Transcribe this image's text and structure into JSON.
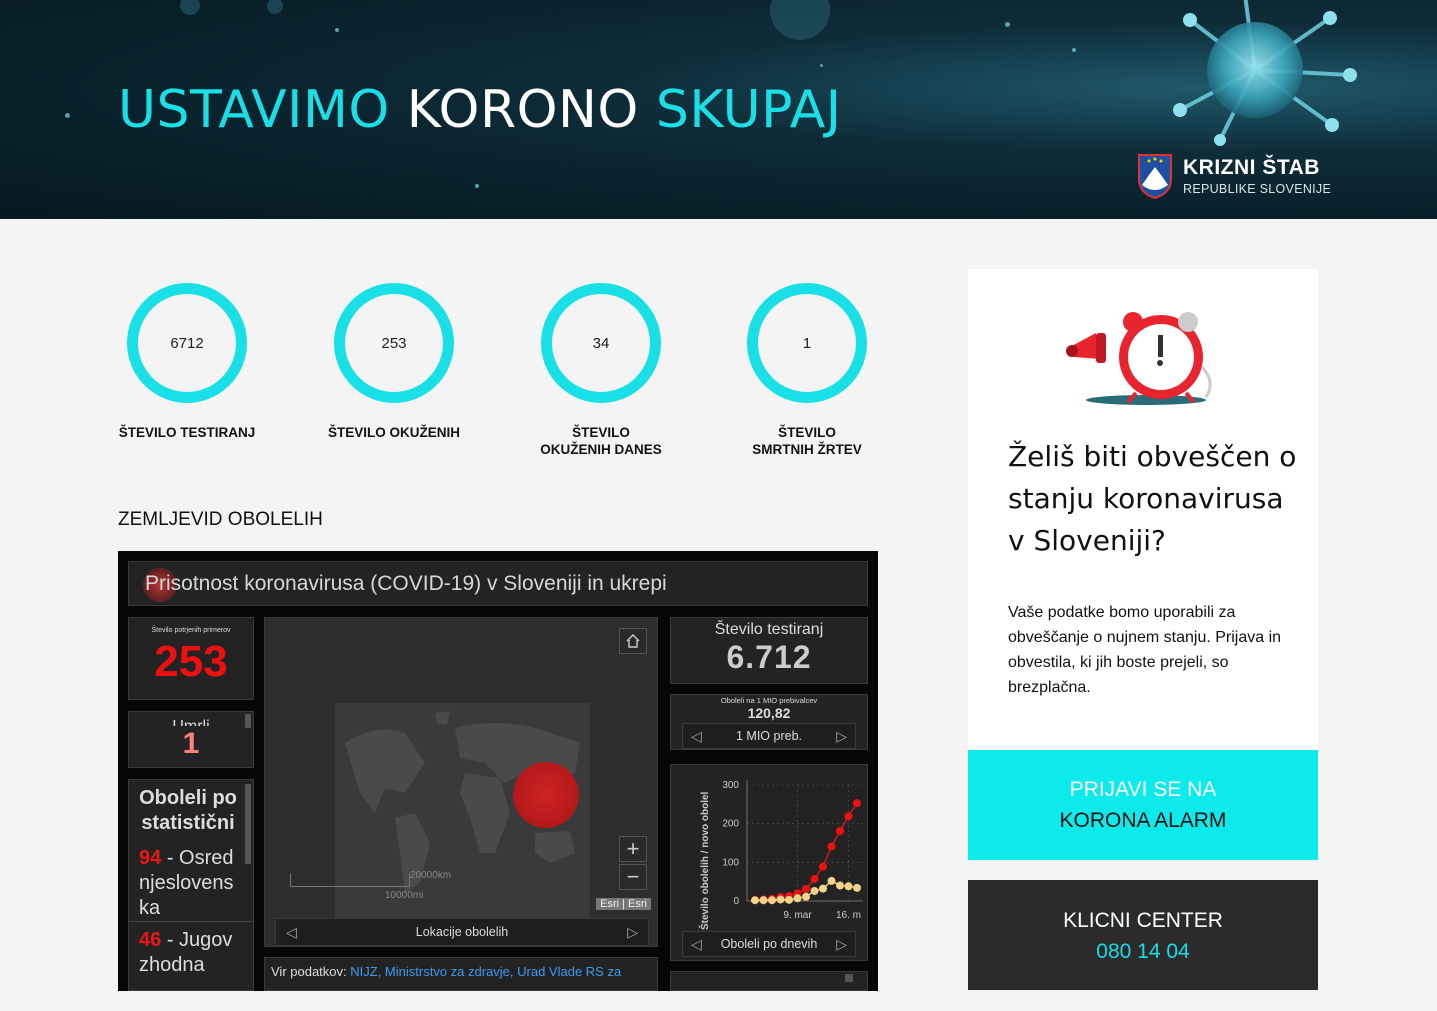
{
  "hero": {
    "title_part1": "USTAVIMO",
    "title_part2": "KORONO",
    "title_part3": "SKUPAJ",
    "logo_title": "KRIZNI ŠTAB",
    "logo_subtitle": "REPUBLIKE SLOVENIJE"
  },
  "stats": [
    {
      "value": "6712",
      "label": "ŠTEVILO TESTIRANJ"
    },
    {
      "value": "253",
      "label": "ŠTEVILO OKUŽENIH"
    },
    {
      "value": "34",
      "label": "ŠTEVILO OKUŽENIH DANES"
    },
    {
      "value": "1",
      "label": "ŠTEVILO SMRTNIH ŽRTEV"
    }
  ],
  "map_section_title": "ZEMLJEVID OBOLELIH",
  "dashboard": {
    "header": "Prisotnost koronavirusa (COVID-19) v Sloveniji in ukrepi",
    "confirmed_label": "Število potrjenih primerov",
    "confirmed_value": "253",
    "deaths_label": "Umrli",
    "deaths_value": "1",
    "regions_title": "Oboleli po statistični",
    "regions": [
      {
        "count": "94",
        "name": "Osrednjeslovenska"
      },
      {
        "count": "46",
        "name": "Jugovzhodna"
      }
    ],
    "map_scale_km": "20000km",
    "map_scale_mi": "10000mi",
    "map_attribution": "Esri | Esri",
    "map_nav_label": "Lokacije obolelih",
    "source_label": "Vir podatkov:",
    "source_links": "NIJZ, Ministrstvo za zdravje, Urad Vlade RS za",
    "tests_label": "Število testiranj",
    "tests_value": "6.712",
    "per_million_label": "Oboleli na 1 MIO prebivalcev",
    "per_million_value": "120,82",
    "per_million_nav": "1 MIO preb.",
    "chart_nav": "Oboleli po dnevih",
    "chart_ylabel": "Število obolelih / novo obolel",
    "chart_x_labels": [
      "9. mar",
      "16. m"
    ]
  },
  "chart_data": {
    "type": "line",
    "ylabel": "Število obolelih / novo obolel",
    "ylim": [
      0,
      300
    ],
    "yticks": [
      0,
      100,
      200,
      300
    ],
    "x_tick_labels": [
      "9. mar",
      "16. m"
    ],
    "series": [
      {
        "color": "#ee1111",
        "values": [
          2,
          4,
          6,
          10,
          13,
          20,
          31,
          57,
          89,
          141,
          181,
          219,
          253
        ]
      },
      {
        "color": "#f5d28a",
        "values": [
          2,
          2,
          2,
          4,
          3,
          7,
          11,
          26,
          32,
          52,
          40,
          38,
          34
        ]
      }
    ]
  },
  "signup_card": {
    "heading": "Želiš biti obveščen o stanju koronavirusa v Sloveniji?",
    "body": "Vaše podatke bomo uporabili za obveščanje o nujnem stanju. Prijava in obvestila, ki jih boste prejeli, so brezplačna.",
    "cta_line1": "PRIJAVI SE NA",
    "cta_line2": "KORONA ALARM"
  },
  "call_center": {
    "title": "KLICNI CENTER",
    "phone": "080 14 04"
  },
  "colors": {
    "accent": "#18e0e6",
    "hero_bg": "#0b2630",
    "alert_red": "#ee1111"
  }
}
